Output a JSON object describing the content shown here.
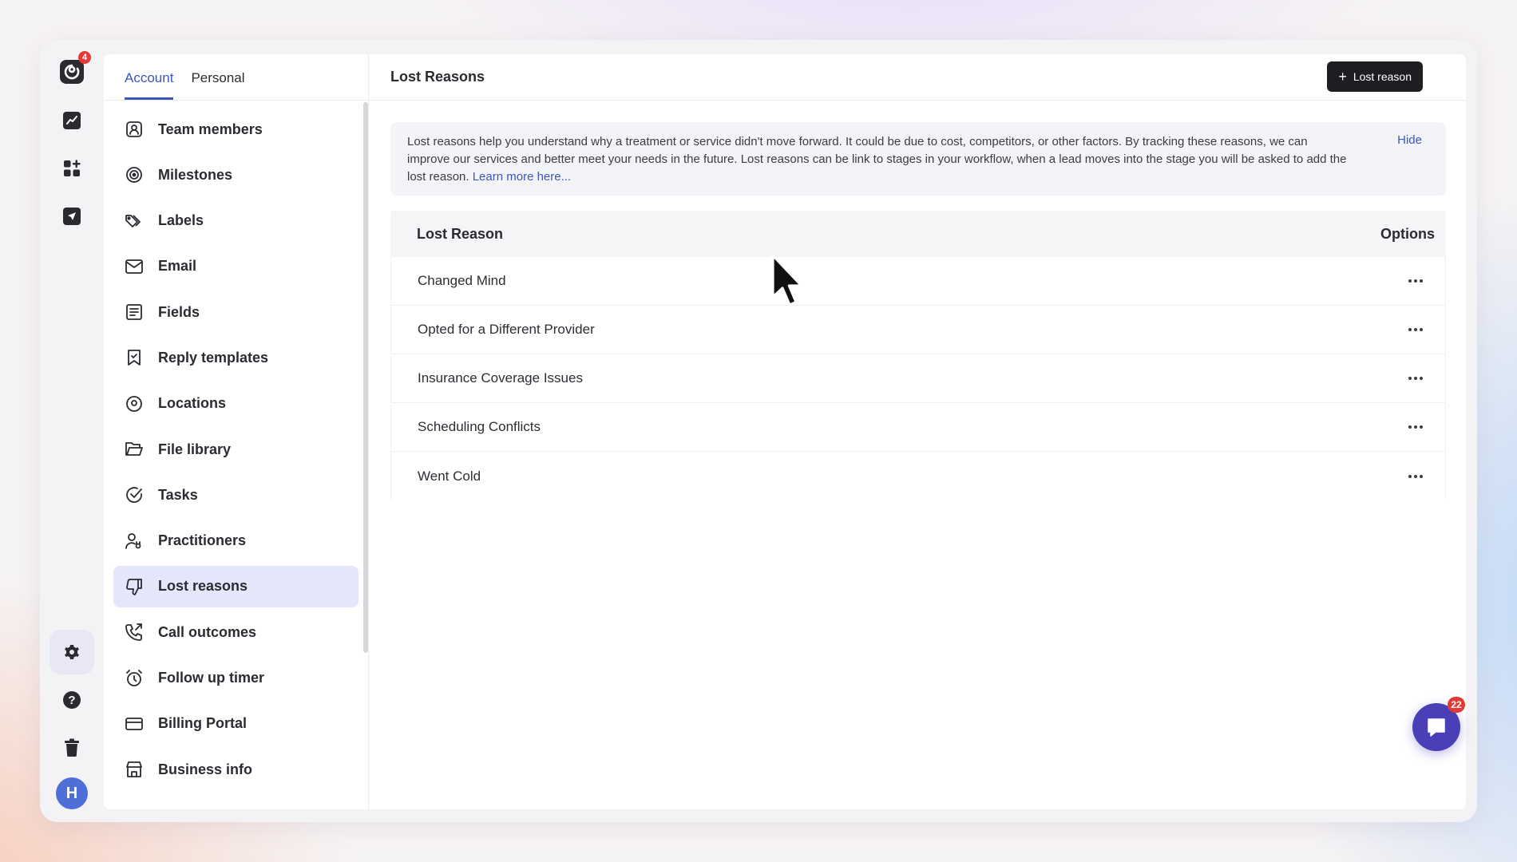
{
  "rail": {
    "app_badge": "4",
    "avatar_letter": "H"
  },
  "sidebar": {
    "tabs": [
      {
        "label": "Account",
        "active": true
      },
      {
        "label": "Personal",
        "active": false
      }
    ],
    "items": [
      {
        "label": "Team members",
        "icon": "user-square-icon"
      },
      {
        "label": "Milestones",
        "icon": "target-icon"
      },
      {
        "label": "Labels",
        "icon": "tags-icon"
      },
      {
        "label": "Email",
        "icon": "mail-icon"
      },
      {
        "label": "Fields",
        "icon": "list-icon"
      },
      {
        "label": "Reply templates",
        "icon": "bookmark-check-icon"
      },
      {
        "label": "Locations",
        "icon": "map-pin-icon"
      },
      {
        "label": "File library",
        "icon": "folder-icon"
      },
      {
        "label": "Tasks",
        "icon": "check-circle-icon"
      },
      {
        "label": "Practitioners",
        "icon": "user-doctor-icon"
      },
      {
        "label": "Lost reasons",
        "icon": "thumbs-down-icon",
        "active": true
      },
      {
        "label": "Call outcomes",
        "icon": "phone-call-icon"
      },
      {
        "label": "Follow up timer",
        "icon": "alarm-clock-icon"
      },
      {
        "label": "Billing Portal",
        "icon": "credit-card-icon"
      },
      {
        "label": "Business info",
        "icon": "store-icon"
      }
    ]
  },
  "main": {
    "title": "Lost Reasons",
    "add_button_label": "Lost reason",
    "info": {
      "text": "Lost reasons help you understand why a treatment or service didn't move forward. It could be due to cost, competitors, or other factors. By tracking these reasons, we can improve our services and better meet your needs in the future. Lost reasons can be link to stages in your workflow, when a lead moves into the stage you will be asked to add the lost reason.",
      "link_text": "Learn more here...",
      "hide_label": "Hide"
    },
    "table": {
      "col_reason": "Lost Reason",
      "col_options": "Options",
      "rows": [
        "Changed Mind",
        "Opted for a Different Provider",
        "Insurance Coverage Issues",
        "Scheduling Conflicts",
        "Went Cold"
      ]
    }
  },
  "chat": {
    "badge": "22"
  },
  "colors": {
    "accent": "#3d56b8",
    "active_bg": "#e4e6fa",
    "button_dark": "#1d1d22",
    "badge_red": "#e53935",
    "chat_purple": "#4b3fb8"
  }
}
